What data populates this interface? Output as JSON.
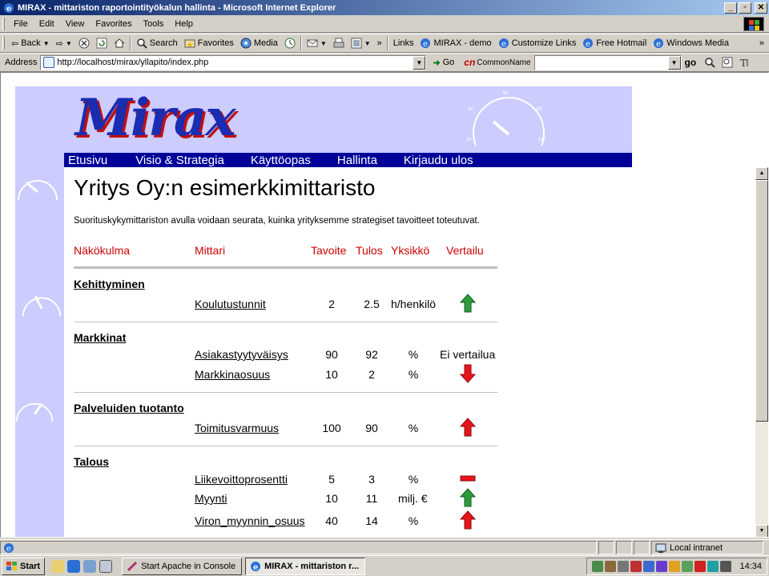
{
  "window": {
    "title": "MIRAX - mittariston raportointityökalun hallinta - Microsoft Internet Explorer",
    "btn_minimize": "_",
    "btn_maximize": "▫",
    "btn_close": "✕"
  },
  "menu": [
    "File",
    "Edit",
    "View",
    "Favorites",
    "Tools",
    "Help"
  ],
  "toolbar": {
    "back": "Back",
    "search": "Search",
    "favorites": "Favorites",
    "media": "Media",
    "links_label": "Links",
    "links": [
      "MIRAX - demo",
      "Customize Links",
      "Free Hotmail",
      "Windows Media"
    ]
  },
  "address": {
    "label": "Address",
    "url": "http://localhost/mirax/yllapito/index.php",
    "go": "Go",
    "cn_logo": "cn",
    "cn_label": "CommonName",
    "cn_value": "",
    "go2": "go"
  },
  "site": {
    "logo": "Mirax",
    "nav": [
      "Etusivu",
      "Visio & Strategia",
      "Käyttöopas",
      "Hallinta",
      "Kirjaudu ulos"
    ],
    "title": "Yritys Oy:n esimerkkimittaristo",
    "intro": "Suorituskykymittariston avulla voidaan seurata, kuinka yrityksemme strategiset tavoitteet toteutuvat.",
    "gauge_ticks": [
      "0",
      "20",
      "40",
      "60",
      "80",
      "100"
    ]
  },
  "table": {
    "headers": {
      "perspective": "Näkökulma",
      "metric": "Mittari",
      "target": "Tavoite",
      "result": "Tulos",
      "unit": "Yksikkö",
      "comparison": "Vertailu"
    },
    "groups": [
      {
        "name": "Kehittyminen",
        "rows": [
          {
            "metric": "Koulutustunnit",
            "target": "2",
            "result": "2.5",
            "unit": "h/henkilö",
            "trend": "up-green"
          }
        ]
      },
      {
        "name": "Markkinat",
        "rows": [
          {
            "metric": "Asiakastyytyväisys",
            "target": "90",
            "result": "92",
            "unit": "%",
            "trend": "none",
            "comparison_text": "Ei vertailua"
          },
          {
            "metric": "Markkinaosuus",
            "target": "10",
            "result": "2",
            "unit": "%",
            "trend": "down-red"
          }
        ]
      },
      {
        "name": "Palveluiden tuotanto",
        "rows": [
          {
            "metric": "Toimitusvarmuus",
            "target": "100",
            "result": "90",
            "unit": "%",
            "trend": "up-red"
          }
        ]
      },
      {
        "name": "Talous",
        "rows": [
          {
            "metric": "Liikevoittoprosentti",
            "target": "5",
            "result": "3",
            "unit": "%",
            "trend": "flat-red"
          },
          {
            "metric": "Myynti",
            "target": "10",
            "result": "11",
            "unit": "milj. €",
            "trend": "up-green"
          },
          {
            "metric": "Viron_myynnin_osuus",
            "target": "40",
            "result": "14",
            "unit": "%",
            "trend": "up-red"
          }
        ]
      }
    ]
  },
  "status": {
    "zone": "Local intranet"
  },
  "taskbar": {
    "start": "Start",
    "tasks": [
      "Start Apache in Console",
      "MIRAX - mittariston r..."
    ],
    "clock": "14:34"
  },
  "colors": {
    "nav_bg": "#000099",
    "sidebar_bg": "#ccccff",
    "header_red": "#cc0000",
    "arrow_green": "#2e9a3c",
    "arrow_red": "#e8141c"
  }
}
